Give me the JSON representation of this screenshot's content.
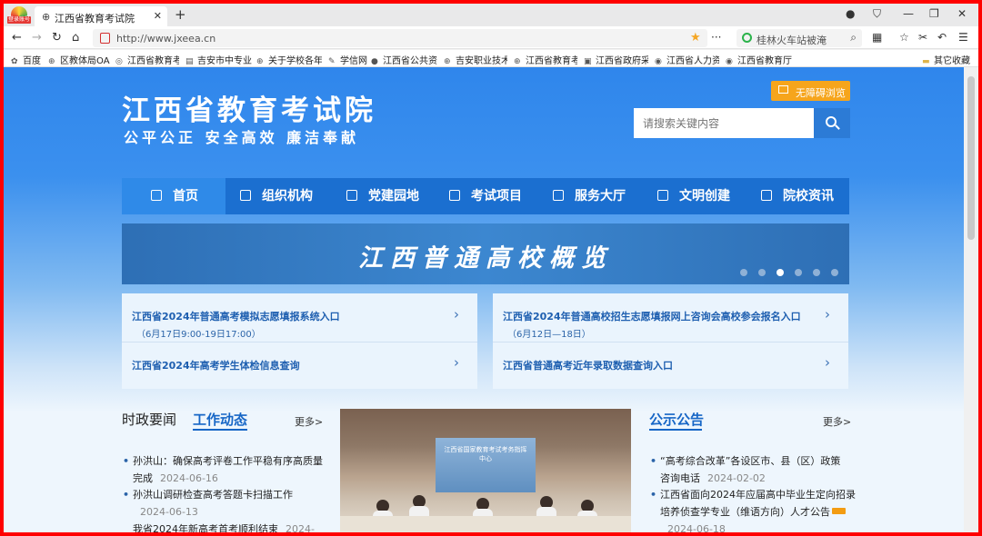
{
  "browser": {
    "logo_badge": "登录账号",
    "tab_title": "江西省教育考试院",
    "url": "http://www.jxeea.cn",
    "search_box": "桂林火车站被淹",
    "bookmarks": [
      "百度",
      "区教体局OA",
      "江西省教育考",
      "吉安市中专业",
      "关于学校各年",
      "学信网",
      "江西省公共资",
      "吉安职业技术",
      "江西省教育考",
      "江西省政府采",
      "江西省人力资",
      "江西省教育厅"
    ],
    "other_bookmarks": "其它收藏"
  },
  "header": {
    "title": "江西省教育考试院",
    "slogan": "公平公正  安全高效  廉洁奉献",
    "accessibility": "无障碍浏览",
    "search_placeholder": "请搜索关键内容"
  },
  "nav": {
    "items": [
      "首页",
      "组织机构",
      "党建园地",
      "考试项目",
      "服务大厅",
      "文明创建",
      "院校资讯"
    ],
    "active_index": 0
  },
  "banner": {
    "text": "江西普通高校概览",
    "dot_count": 6,
    "active_dot": 2
  },
  "links": {
    "left": [
      {
        "title": "江西省2024年普通高考模拟志愿填报系统入口",
        "sub": "（6月17日9:00-19日17:00）"
      },
      {
        "title": "江西省2024年高考学生体检信息查询",
        "sub": ""
      }
    ],
    "right": [
      {
        "title": "江西省2024年普通高校招生志愿填报网上咨询会高校参会报名入口",
        "sub": "（6月12日—18日）"
      },
      {
        "title": "江西省普通高考近年录取数据查询入口",
        "sub": ""
      }
    ]
  },
  "news": {
    "tab_politics": "时政要闻",
    "tab_work": "工作动态",
    "more": "更多>",
    "items": [
      {
        "title_line1": "孙洪山：确保高考评卷工作平稳有序高质量",
        "title_line2": "完成",
        "date": "2024-06-16"
      },
      {
        "title_line1": "孙洪山调研检查高考答题卡扫描工作",
        "title_line2": "",
        "date": "2024-06-13"
      },
      {
        "title_line1": "我省2024年新高考首考顺利结束",
        "title_line2": "",
        "date": "2024-"
      }
    ]
  },
  "photo": {
    "screen_text": "江西省国家教育考试考务指挥中心"
  },
  "notice": {
    "title": "公示公告",
    "more": "更多>",
    "items": [
      {
        "line1": "“高考综合改革”各设区市、县（区）政策",
        "line2": "咨询电话",
        "date": "2024-02-02",
        "new": false
      },
      {
        "line1": "江西省面向2024年应届高中毕业生定向招录",
        "line2": "培养侦查学专业（维语方向）人才公告",
        "date": "2024-06-18",
        "new": true
      }
    ]
  }
}
